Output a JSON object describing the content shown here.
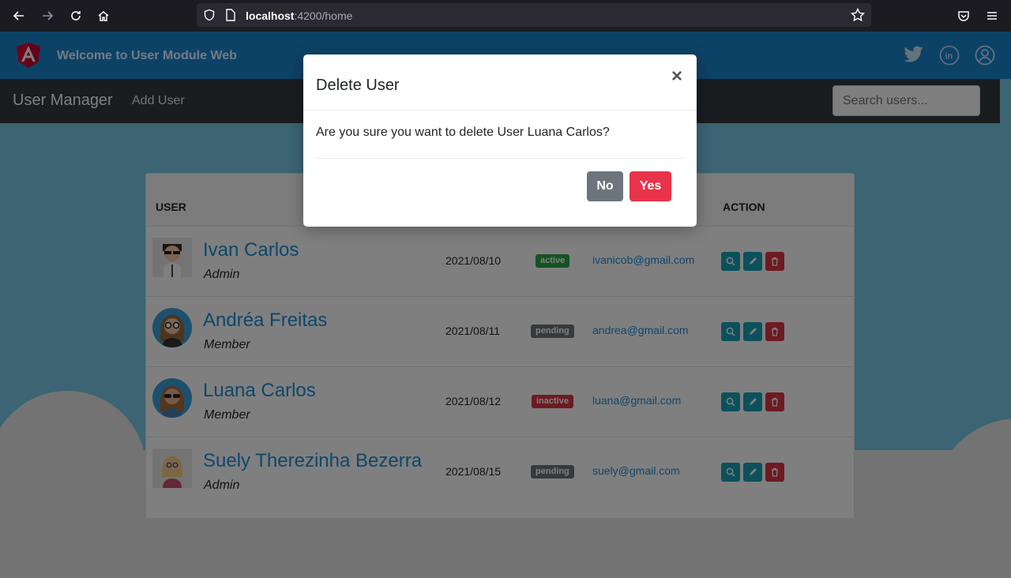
{
  "browser": {
    "url_host": "localhost",
    "url_path": ":4200/home"
  },
  "header": {
    "title": "Welcome to User Module Web"
  },
  "navbar": {
    "brand": "User Manager",
    "add_user": "Add User",
    "search_placeholder": "Search users..."
  },
  "table": {
    "col_user": "USER",
    "col_action": "ACTION",
    "rows": [
      {
        "name": "Ivan Carlos",
        "role": "Admin",
        "date": "2021/08/10",
        "status": "active",
        "email": "ivanicob@gmail.com"
      },
      {
        "name": "Andréa Freitas",
        "role": "Member",
        "date": "2021/08/11",
        "status": "pending",
        "email": "andrea@gmail.com"
      },
      {
        "name": "Luana Carlos",
        "role": "Member",
        "date": "2021/08/12",
        "status": "inactive",
        "email": "luana@gmail.com"
      },
      {
        "name": "Suely Therezinha Bezerra",
        "role": "Admin",
        "date": "2021/08/15",
        "status": "pending",
        "email": "suely@gmail.com"
      }
    ]
  },
  "modal": {
    "title": "Delete User",
    "close": "×",
    "message": "Are you sure you want to delete User Luana Carlos?",
    "no_label": "No",
    "yes_label": "Yes"
  },
  "colors": {
    "header": "#1a84cf",
    "navbar": "#343a40",
    "sky": "#79c8e6",
    "link": "#1c8fd6",
    "active": "#28a745",
    "pending": "#6c757d",
    "inactive": "#dc3545",
    "action_teal": "#17a2b8",
    "danger": "#dc3545"
  },
  "icons": [
    "back-arrow-icon",
    "forward-arrow-icon",
    "reload-icon",
    "home-icon",
    "shield-icon",
    "page-icon",
    "star-icon",
    "pocket-icon",
    "menu-icon",
    "angular-logo",
    "twitter-icon",
    "linkedin-icon",
    "user-circle-icon",
    "zoom-icon",
    "pencil-icon",
    "trash-icon"
  ]
}
